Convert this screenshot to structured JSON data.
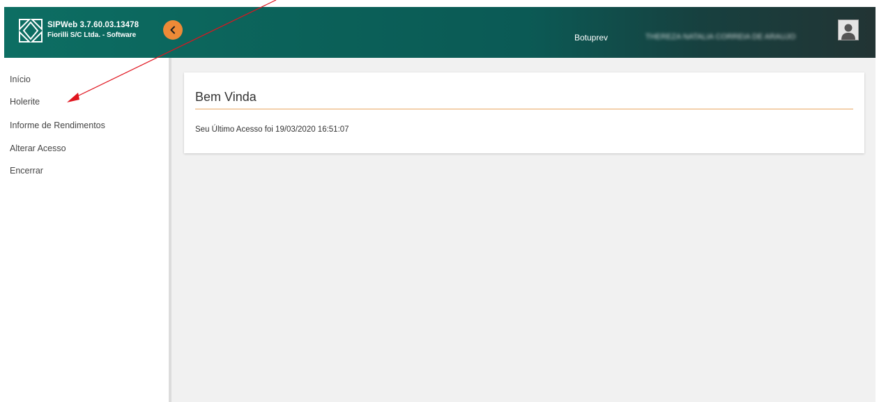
{
  "app": {
    "title": "SIPWeb 3.7.60.03.13478",
    "company": "Fiorilli S/C Ltda. - Software"
  },
  "header": {
    "org": "Botuprev",
    "user_name": "THEREZA NATALIA CORREIA DE ARAUJO",
    "collapse_icon": "chevron-left-icon",
    "avatar_icon": "user-avatar-icon"
  },
  "sidebar": {
    "items": [
      {
        "label": "Início"
      },
      {
        "label": "Holerite"
      },
      {
        "label": "Informe de Rendimentos"
      },
      {
        "label": "Alterar Acesso"
      },
      {
        "label": "Encerrar"
      }
    ]
  },
  "main": {
    "title": "Bem Vinda",
    "last_access": "Seu Último Acesso foi 19/03/2020 16:51:07"
  },
  "colors": {
    "header_start": "#0d6e63",
    "header_end": "#223434",
    "accent": "#ee8a37",
    "divider": "#e9a45f",
    "annotation_arrow": "#e0141e"
  }
}
